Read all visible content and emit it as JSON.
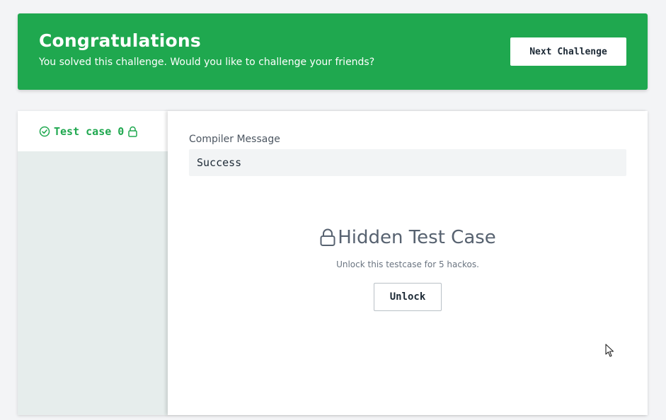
{
  "banner": {
    "title": "Congratulations",
    "subtitle": "You solved this challenge. Would you like to challenge your friends?",
    "next_button": "Next Challenge",
    "background_color": "#1fa84f"
  },
  "sidebar": {
    "tabs": [
      {
        "label": "Test case 0",
        "status_icon": "check-circle-icon",
        "lock_icon": "lock-icon",
        "active": true
      }
    ]
  },
  "main": {
    "compiler_label": "Compiler Message",
    "compiler_value": "Success",
    "hidden_title": "Hidden Test Case",
    "unlock_note": "Unlock this testcase for 5 hackos.",
    "unlock_button": "Unlock"
  }
}
